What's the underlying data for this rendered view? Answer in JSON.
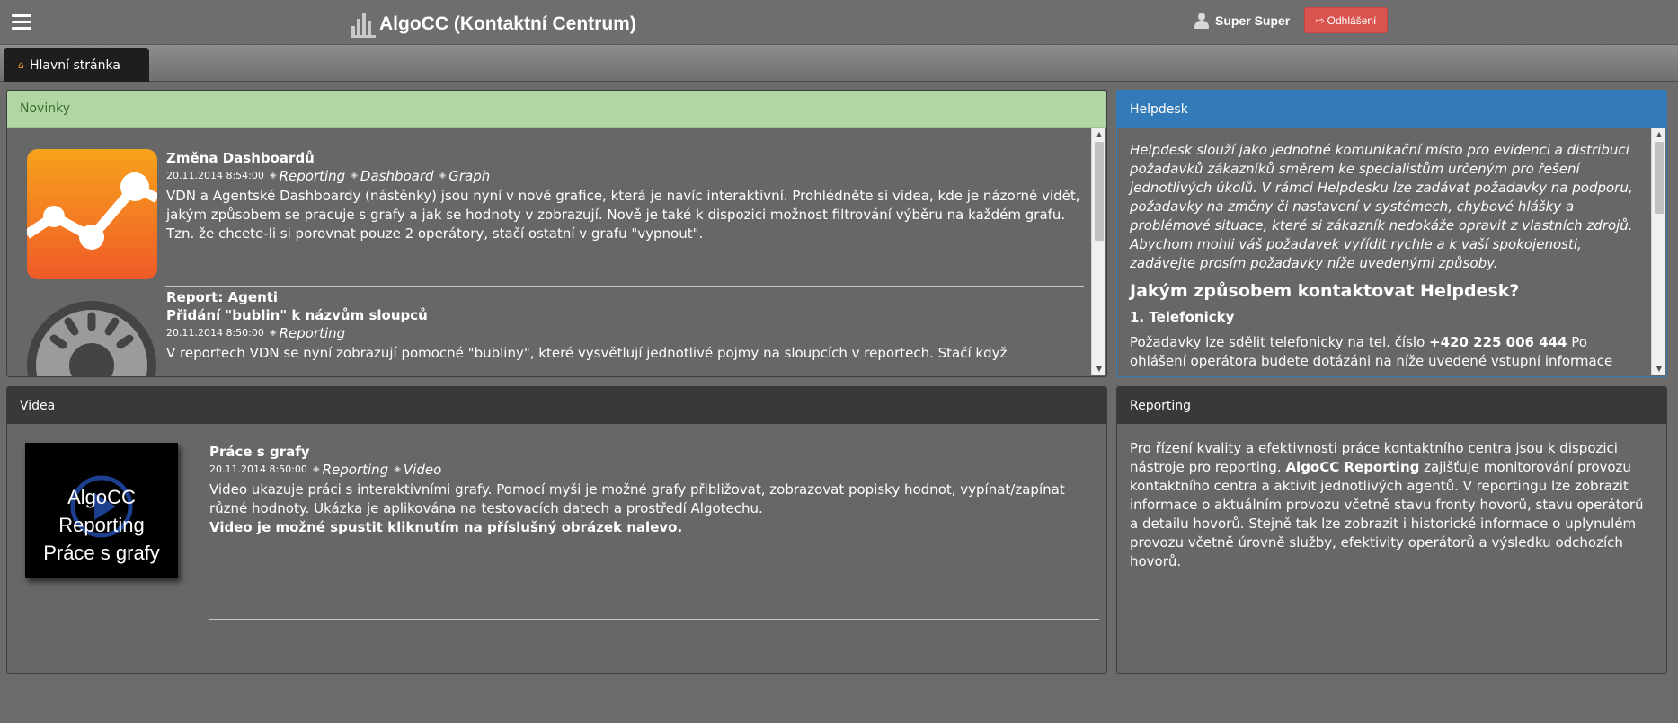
{
  "app": {
    "title": "AlgoCC (Kontaktní Centrum)",
    "user_name": "Super Super",
    "logout_label": "Odhlášení"
  },
  "tabs": [
    {
      "label": "Hlavní stránka",
      "icon": "home-icon"
    }
  ],
  "news": {
    "heading": "Novinky",
    "items": [
      {
        "title": "Změna Dashboardů",
        "date": "20.11.2014 8:54:00",
        "tags": [
          "Reporting",
          "Dashboard",
          "Graph"
        ],
        "text": "VDN a Agentské Dashboardy (nástěnky) jsou nyní v nové grafice, která je navíc interaktivní. Prohlédněte si videa, kde je názorně vidět, jakým způsobem se pracuje s grafy a jak se hodnoty v zobrazují. Nově je také k dispozici možnost filtrování výběru na každém grafu. Tzn. že chcete-li si porovnat pouze 2 operátory, stačí ostatní v grafu \"vypnout\".",
        "image": "chart-thumbnail-icon"
      },
      {
        "title_line1": "Report: Agenti",
        "title_line2": "Přidání \"bublin\" k názvům sloupců",
        "date": "20.11.2014 8:50:00",
        "tags": [
          "Reporting"
        ],
        "text": "V reportech VDN se nyní zobrazují pomocné \"bubliny\", které vysvětlují jednotlivé pojmy na sloupcích v reportech. Stačí když",
        "image": "lightbulb-icon"
      }
    ]
  },
  "helpdesk": {
    "heading": "Helpdesk",
    "intro": "Helpdesk slouží jako jednotné komunikační místo pro evidenci a distribuci požadavků zákazníků směrem ke specialistům určeným pro řešení jednotlivých úkolů. V rámci Helpdesku lze zadávat požadavky na podporu, požadavky na změny či nastavení v systémech, chybové hlášky a problémové situace, které si zákazník nedokáže opravit z vlastních zdrojů. Abychom mohli váš požadavek vyřídit rychle a k vaší spokojenosti, zadávejte prosím požadavky níže uvedenými způsoby.",
    "subheading": "Jakým způsobem kontaktovat Helpdesk?",
    "section1_title": "1. Telefonicky",
    "section1_text_a": "Požadavky lze sdělit telefonicky na tel. číslo ",
    "section1_phone": "+420 225 006 444",
    "section1_text_b": " Po ohlášení operátora budete dotázáni na níže uvedené vstupní informace"
  },
  "videos": {
    "heading": "Videa",
    "items": [
      {
        "thumb_line1": "AlgoCC Reporting",
        "thumb_line2": "Práce s grafy",
        "title": "Práce s grafy",
        "date": "20.11.2014 8:50:00",
        "tags": [
          "Reporting",
          "Video"
        ],
        "text": "Video ukazuje práci s interaktivními grafy. Pomocí myši je možné grafy přibližovat, zobrazovat popisky hodnot, vypínat/zapínat různé hodnoty. Ukázka je aplikována na testovacích datech a prostředí Algotechu.",
        "text_bold": "Video je možné spustit kliknutím na příslušný obrázek nalevo."
      }
    ]
  },
  "reporting": {
    "heading": "Reporting",
    "text_a": "Pro řízení kvality a efektivnosti práce kontaktního centra jsou k dispozici nástroje pro reporting. ",
    "text_bold": "AlgoCC Reporting",
    "text_b": " zajišťuje monitorování provozu kontaktního centra a aktivit jednotlivých agentů. V reportingu lze zobrazit informace o aktuálním provozu včetně stavu fronty hovorů, stavu operátorů a detailu hovorů. Stejně tak lze zobrazit i historické informace o uplynulém provozu včetně úrovně služby, efektivity operátorů a výsledku odchozích hovorů."
  },
  "colors": {
    "news_header": "#b2d6a3",
    "helpdesk_header": "#327ab8",
    "logout_button": "#d9534f",
    "dark_header": "#393939"
  }
}
